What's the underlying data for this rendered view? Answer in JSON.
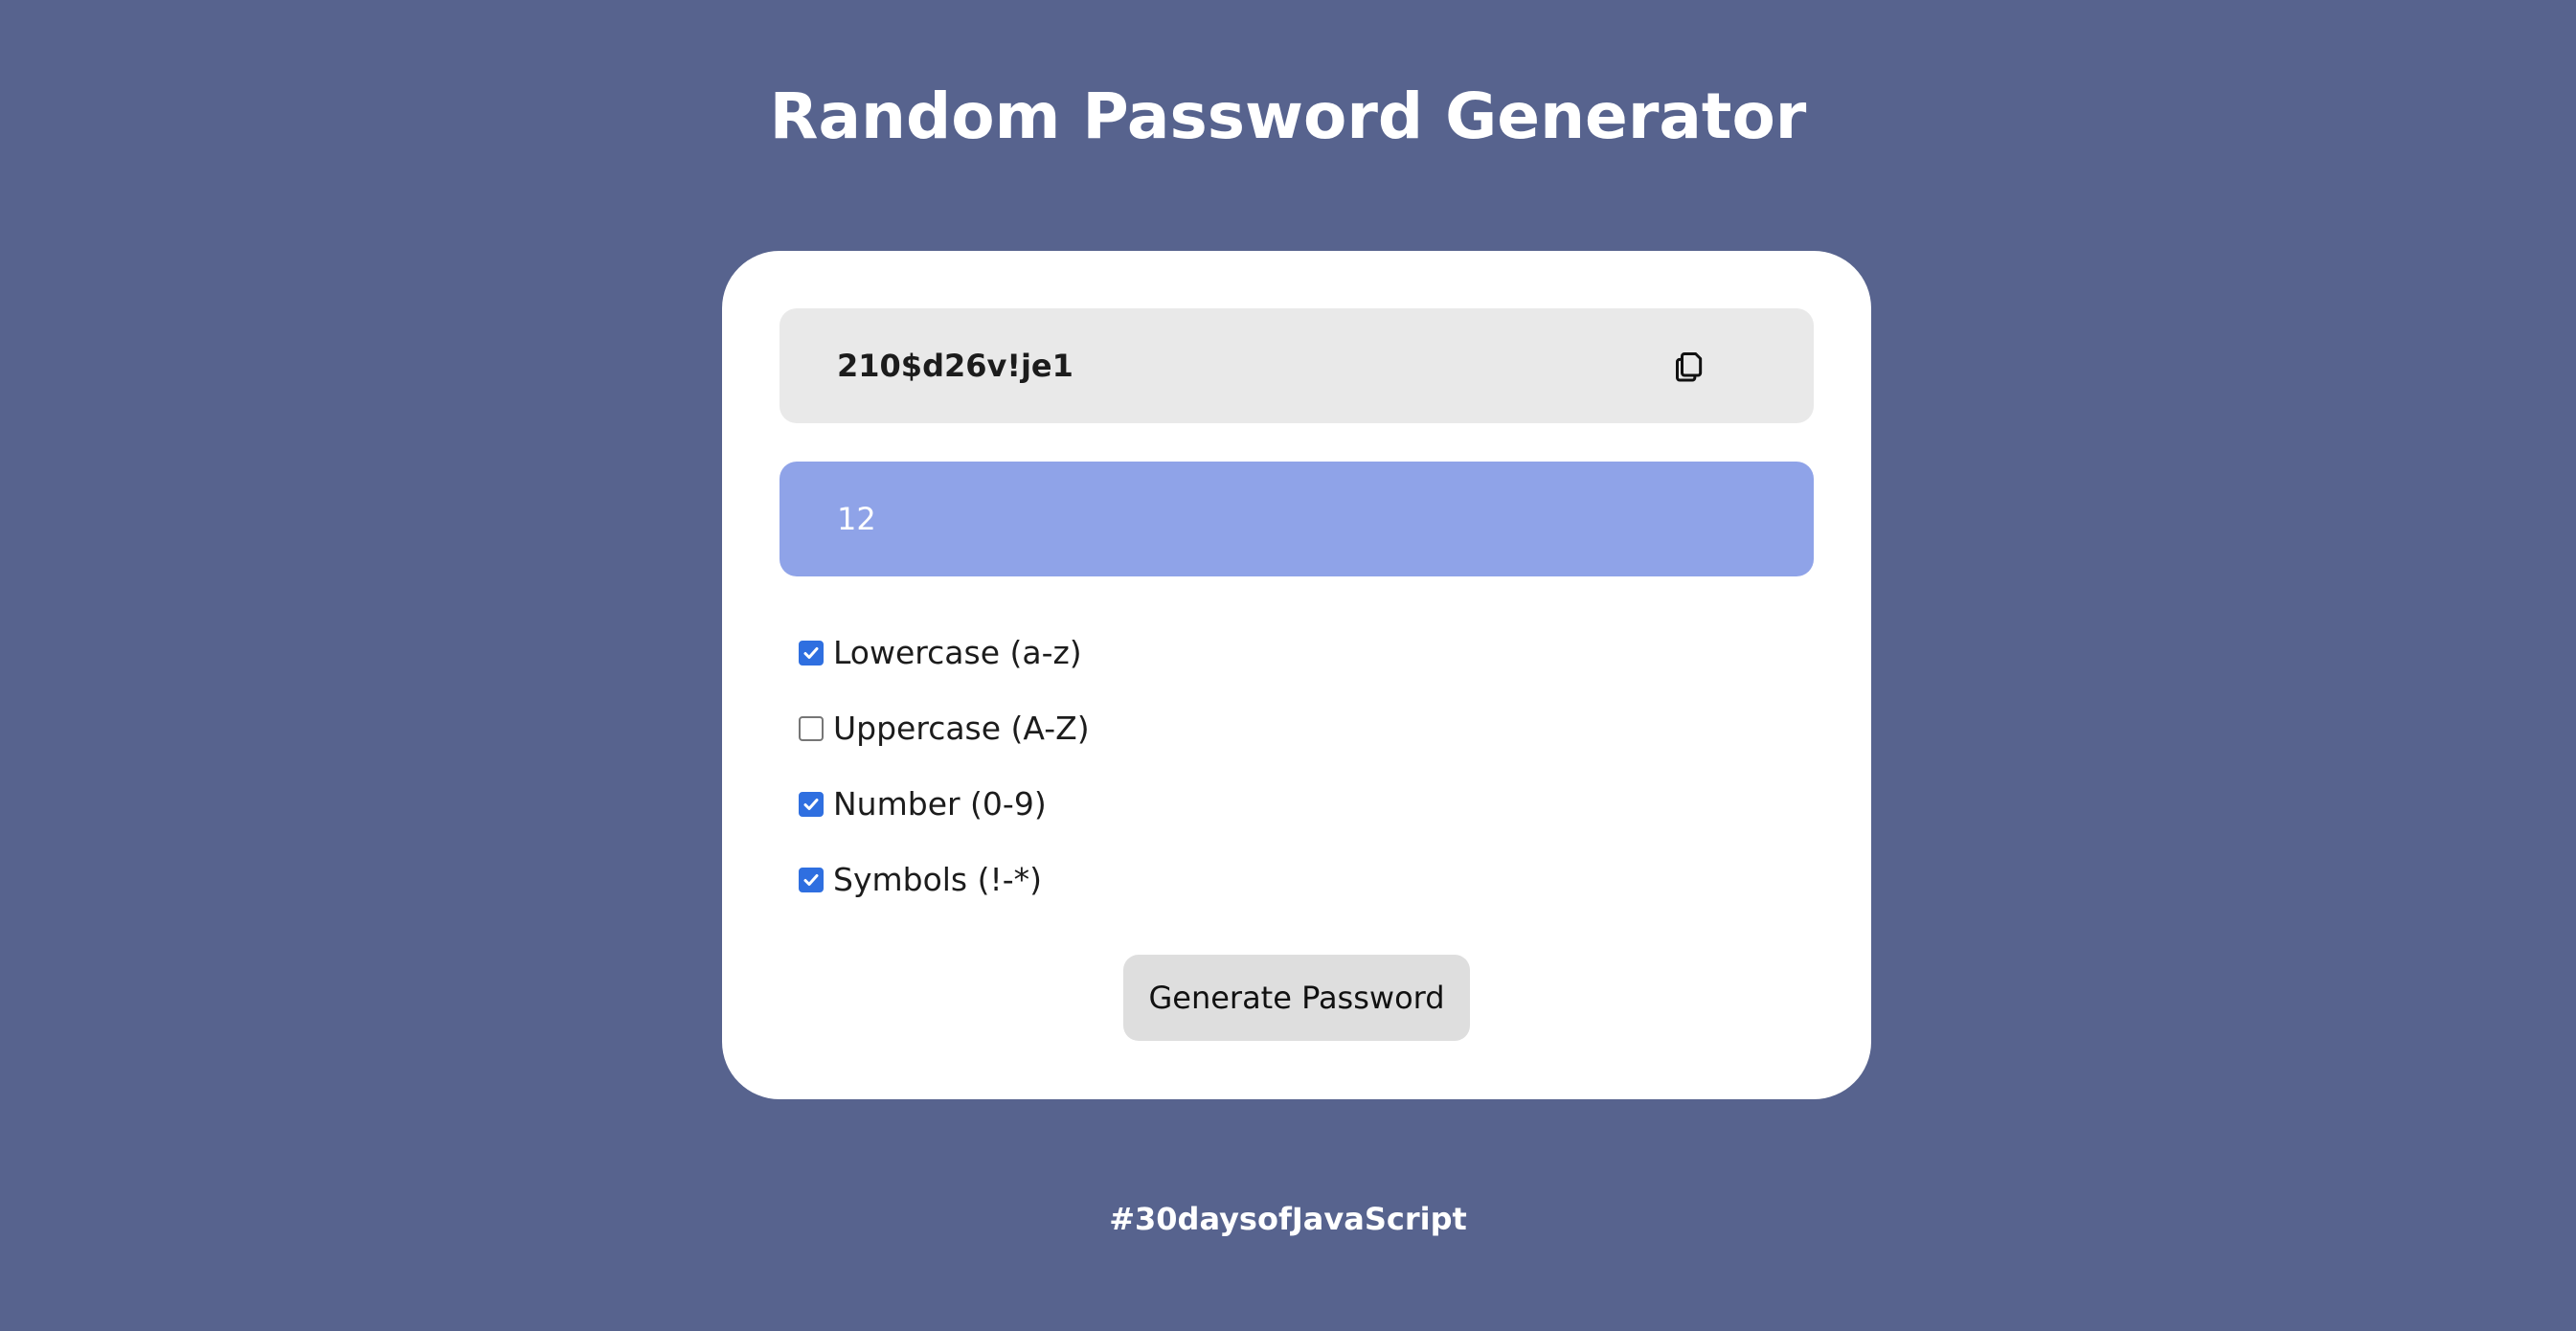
{
  "header": {
    "title": "Random Password Generator"
  },
  "password": {
    "value": "210$d26v!je1",
    "copy_icon": "copy-icon"
  },
  "length": {
    "value": "12"
  },
  "options": [
    {
      "label": "Lowercase (a-z)",
      "checked": true
    },
    {
      "label": "Uppercase (A-Z)",
      "checked": false
    },
    {
      "label": "Number (0-9)",
      "checked": true
    },
    {
      "label": "Symbols (!-*)",
      "checked": true
    }
  ],
  "actions": {
    "generate_label": "Generate Password"
  },
  "footer": {
    "tag": "#30daysofJavaScript"
  },
  "colors": {
    "background": "#57638e",
    "card": "#ffffff",
    "password_box": "#e9e9e9",
    "length_box": "#8fa3e8",
    "checkbox_checked": "#2f6fe0",
    "button": "#dedede"
  }
}
